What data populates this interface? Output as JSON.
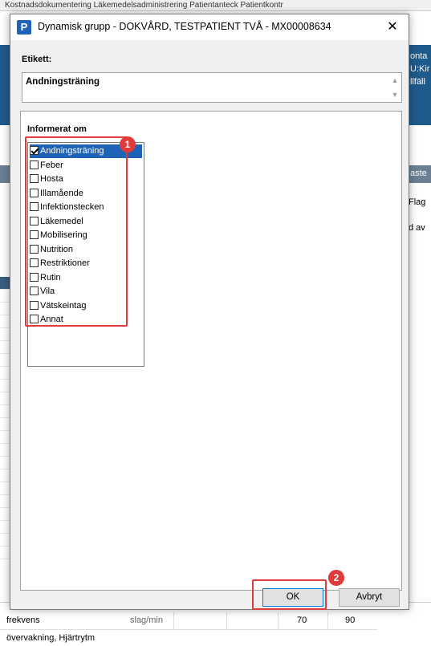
{
  "background": {
    "topbar_text": "Kostnadsdokumentering  Läkemedelsadministrering  Patientanteck  Patientkontr",
    "right_blue_lines": [
      "onta",
      "U:Kir",
      "llfäll"
    ],
    "right_tab": "aste",
    "right_col_labels": [
      "Flag",
      "d av"
    ],
    "table_rows": [
      {
        "label": "frekvens",
        "unit": "slag/min",
        "v1": "70",
        "v2": "90"
      },
      {
        "label": "övervakning, Hjärtrytm",
        "unit": "",
        "v1": "",
        "v2": ""
      }
    ]
  },
  "dialog": {
    "title": "Dynamisk grupp - DOKVÅRD, TESTPATIENT TVÅ - MX00008634",
    "app_icon_letter": "P",
    "close_glyph": "✕",
    "etikett_label": "Etikett:",
    "etikett_value": "Andningsträning",
    "group_label": "Informerat om",
    "items": [
      {
        "label": "Andningsträning",
        "checked": true,
        "selected": true
      },
      {
        "label": "Feber",
        "checked": false,
        "selected": false
      },
      {
        "label": "Hosta",
        "checked": false,
        "selected": false
      },
      {
        "label": "Illamående",
        "checked": false,
        "selected": false
      },
      {
        "label": "Infektionstecken",
        "checked": false,
        "selected": false
      },
      {
        "label": "Läkemedel",
        "checked": false,
        "selected": false
      },
      {
        "label": "Mobilisering",
        "checked": false,
        "selected": false
      },
      {
        "label": "Nutrition",
        "checked": false,
        "selected": false
      },
      {
        "label": "Restriktioner",
        "checked": false,
        "selected": false
      },
      {
        "label": "Rutin",
        "checked": false,
        "selected": false
      },
      {
        "label": "Vila",
        "checked": false,
        "selected": false
      },
      {
        "label": "Vätskeintag",
        "checked": false,
        "selected": false
      },
      {
        "label": "Annat",
        "checked": false,
        "selected": false
      }
    ],
    "ok_label": "OK",
    "cancel_label": "Avbryt"
  },
  "annotations": {
    "badge_1": "1",
    "badge_2": "2",
    "color": "#e03a3a"
  },
  "colors": {
    "selection": "#1e63b5",
    "header_blue": "#1f5a8c"
  }
}
